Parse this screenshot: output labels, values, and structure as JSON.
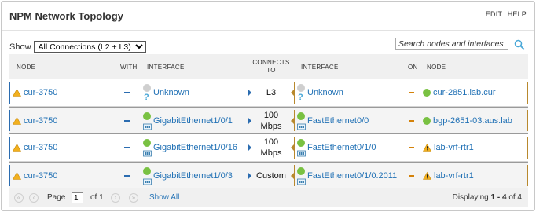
{
  "panel": {
    "title": "NPM Network Topology",
    "edit_label": "EDIT",
    "help_label": "HELP"
  },
  "toolbar": {
    "show_label": "Show",
    "selected_view": "All Connections (L2 + L3)",
    "search_placeholder": "Search nodes and interfaces"
  },
  "columns": {
    "node": "NODE",
    "with": "WITH",
    "interface": "INTERFACE",
    "connects_to_1": "CONNECTS",
    "connects_to_2": "TO",
    "interface2": "INTERFACE",
    "on": "ON",
    "node2": "NODE"
  },
  "rows": [
    {
      "node": "cur-3750",
      "node_status": "warning",
      "interface": "Unknown",
      "interface_status": "unknown",
      "connects_to_1": "L3",
      "connects_to_2": "",
      "remote_interface": "Unknown",
      "remote_interface_status": "unknown",
      "remote_node": "cur-2851.lab.cur",
      "remote_node_status": "up"
    },
    {
      "node": "cur-3750",
      "node_status": "warning",
      "interface": "GigabitEthernet1/0/1",
      "interface_status": "up",
      "connects_to_1": "100",
      "connects_to_2": "Mbps",
      "remote_interface": "FastEthernet0/0",
      "remote_interface_status": "up",
      "remote_node": "bgp-2651-03.aus.lab",
      "remote_node_status": "up"
    },
    {
      "node": "cur-3750",
      "node_status": "warning",
      "interface": "GigabitEthernet1/0/16",
      "interface_status": "up",
      "connects_to_1": "100",
      "connects_to_2": "Mbps",
      "remote_interface": "FastEthernet0/1/0",
      "remote_interface_status": "up",
      "remote_node": "lab-vrf-rtr1",
      "remote_node_status": "warning"
    },
    {
      "node": "cur-3750",
      "node_status": "warning",
      "interface": "GigabitEthernet1/0/3",
      "interface_status": "up",
      "connects_to_1": "Custom",
      "connects_to_2": "",
      "remote_interface": "FastEthernet0/1/0.2011",
      "remote_interface_status": "up",
      "remote_node": "lab-vrf-rtr1",
      "remote_node_status": "warning"
    }
  ],
  "pager": {
    "page_label": "Page",
    "page_value": "1",
    "of_label": "of 1",
    "show_all": "Show All",
    "displaying_label": "Displaying",
    "displaying_range": "1 - 4",
    "displaying_of": "of 4"
  },
  "colors": {
    "link": "#2171b5",
    "up": "#79c142",
    "unknown": "#cfcfcf",
    "warning": "#f2b01e",
    "local_accent": "#2b6cb0",
    "remote_accent": "#b8892e"
  },
  "icons": {
    "node_warning": "warning-triangle-icon",
    "status_up": "green-status-dot-icon",
    "status_unknown": "gray-status-dot-icon",
    "interface_type": "ethernet-port-icon",
    "search": "magnifier-icon"
  }
}
